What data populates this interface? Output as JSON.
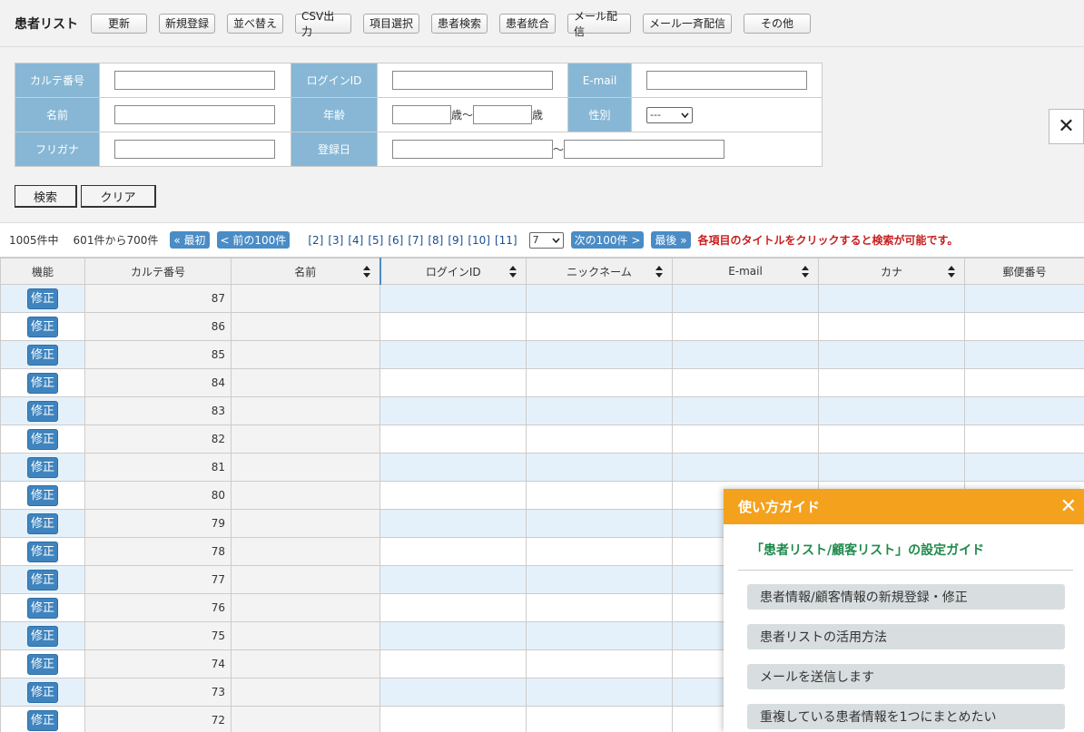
{
  "toolbar": {
    "title": "患者リスト",
    "buttons": [
      "更新",
      "新規登録",
      "並べ替え",
      "CSV出力",
      "項目選択",
      "患者検索",
      "患者統合",
      "メール配信",
      "メール一斉配信",
      "その他"
    ]
  },
  "search": {
    "karte_label": "カルテ番号",
    "login_label": "ログインID",
    "email_label": "E-mail",
    "name_label": "名前",
    "age_label": "年齢",
    "age_unit": "歳",
    "age_sep": "〜",
    "gender_label": "性別",
    "gender_value": "---",
    "kana_label": "フリガナ",
    "regdate_label": "登録日",
    "date_sep": "〜",
    "search_button": "検索",
    "clear_button": "クリア",
    "close_icon": "close-icon"
  },
  "pager": {
    "total": "1005件中",
    "range": "601件から700件",
    "first": "« 最初",
    "prev": "< 前の100件",
    "pages": [
      "[2]",
      "[3]",
      "[4]",
      "[5]",
      "[6]",
      "[7]",
      "[8]",
      "[9]",
      "[10]",
      "[11]"
    ],
    "current_page": "7",
    "next": "次の100件 >",
    "last": "最後 »",
    "hint": "各項目のタイトルをクリックすると検索が可能です。"
  },
  "grid": {
    "headers": [
      "機能",
      "カルテ番号",
      "名前",
      "ログインID",
      "ニックネーム",
      "E-mail",
      "カナ",
      "郵便番号"
    ],
    "fix_label": "修正",
    "rows": [
      87,
      86,
      85,
      84,
      83,
      82,
      81,
      80,
      79,
      78,
      77,
      76,
      75,
      74,
      73,
      72
    ]
  },
  "guide": {
    "title": "使い方ガイド",
    "subtitle": "「患者リスト/顧客リスト」の設定ガイド",
    "items": [
      "患者情報/顧客情報の新規登録・修正",
      "患者リストの活用方法",
      "メールを送信します",
      "重複している患者情報を1つにまとめたい"
    ]
  },
  "colors": {
    "accent": "#4a8cc6",
    "label_bg": "#87b7d5",
    "guide_head": "#f4a11d",
    "hint": "#c81e1e"
  }
}
